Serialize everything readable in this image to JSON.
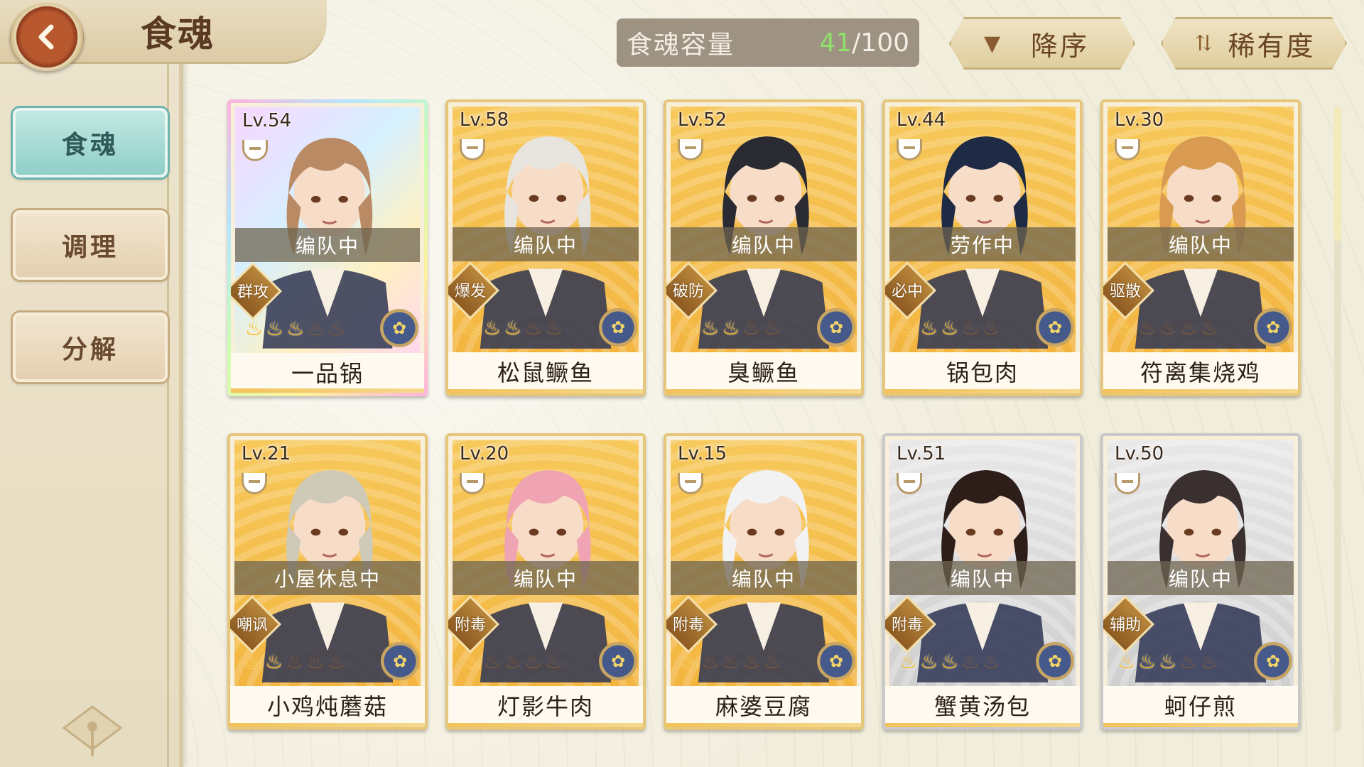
{
  "header": {
    "title": "食魂"
  },
  "sidebar": {
    "items": [
      {
        "label": "食魂",
        "active": true
      },
      {
        "label": "调理",
        "active": false
      },
      {
        "label": "分解",
        "active": false
      }
    ]
  },
  "topbar": {
    "capacity_label": "食魂容量",
    "capacity_current": "41",
    "capacity_max": "/100",
    "order_button": "降序",
    "order_icon": "triangle-down-icon",
    "sort_button": "稀有度",
    "sort_icon": "sort-arrows-icon"
  },
  "colors": {
    "accent_teal": "#8fcfc8",
    "card_gold": "#f3b540",
    "capacity_green": "#8fe06a"
  },
  "cards": [
    {
      "level": "Lv.54",
      "status": "编队中",
      "role": "群攻",
      "name": "一品锅",
      "stars": 3,
      "frame": "rainbow",
      "hair": "#b98a64"
    },
    {
      "level": "Lv.58",
      "status": "编队中",
      "role": "爆发",
      "name": "松鼠鳜鱼",
      "stars": 3,
      "frame": "gold",
      "hair": "#e8e4de"
    },
    {
      "level": "Lv.52",
      "status": "编队中",
      "role": "破防",
      "name": "臭鳜鱼",
      "stars": 3,
      "frame": "gold",
      "hair": "#2a2a33"
    },
    {
      "level": "Lv.44",
      "status": "劳作中",
      "role": "必中",
      "name": "锅包肉",
      "stars": 3,
      "frame": "gold",
      "hair": "#1f2a45"
    },
    {
      "level": "Lv.30",
      "status": "编队中",
      "role": "驱散",
      "name": "符离集烧鸡",
      "stars": 1,
      "frame": "gold",
      "hair": "#d99a52"
    },
    {
      "level": "Lv.21",
      "status": "小屋休息中",
      "role": "嘲讽",
      "name": "小鸡炖蘑菇",
      "stars": 2,
      "frame": "gold",
      "hair": "#cfcab8"
    },
    {
      "level": "Lv.20",
      "status": "编队中",
      "role": "附毒",
      "name": "灯影牛肉",
      "stars": 1,
      "frame": "gold",
      "hair": "#f0a3b3"
    },
    {
      "level": "Lv.15",
      "status": "编队中",
      "role": "附毒",
      "name": "麻婆豆腐",
      "stars": 1,
      "frame": "gold",
      "hair": "#f2f2f2"
    },
    {
      "level": "Lv.51",
      "status": "编队中",
      "role": "附毒",
      "name": "蟹黄汤包",
      "stars": 3,
      "frame": "silver",
      "hair": "#2d1e1a"
    },
    {
      "level": "Lv.50",
      "status": "编队中",
      "role": "辅助",
      "name": "蚵仔煎",
      "stars": 3,
      "frame": "silver",
      "hair": "#3a3030"
    }
  ]
}
